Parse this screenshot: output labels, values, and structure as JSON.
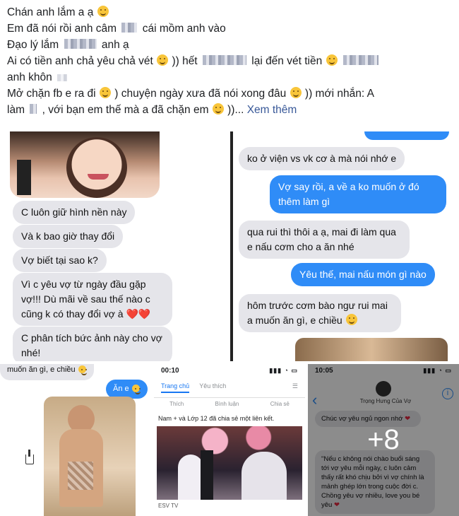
{
  "post": {
    "line1": "Chán anh lắm a ạ",
    "line2a": "Em đã nói rồi anh câm",
    "line2b": "cái mồm anh vào",
    "line3a": "Đạo lý lắm",
    "line3b": "anh ạ",
    "line4a": "Ai có tiền anh chả yêu chả vét",
    "line4b": ")) hết",
    "line4c": "lại đến vét tiền",
    "line5": "anh khôn",
    "line6a": "Mở chặn fb e ra đi",
    "line6b": ") chuyện ngày xưa đã nói xong đâu",
    "line6c": ")) mới nhắn: A",
    "line7a": "làm",
    "line7b": ", với bạn em thế mà a đã chặn em",
    "line7c": "))...",
    "see_more": "Xem thêm"
  },
  "photo1": {
    "messages": [
      "C luôn giữ hình nền này",
      "Và k bao giờ thay đổi",
      "Vợ biết tại sao k?",
      "Vì c yêu vợ từ ngày đầu gặp vợ!!! Dù mãi về sau thế nào c cũng k có thay đổi vợ à",
      "C phân tích bức ảnh này cho vợ nhé!"
    ],
    "hearts": "❤️❤️"
  },
  "photo2": {
    "messages": [
      {
        "dir": "in",
        "text": "ko ở viện vs vk cơ à mà nói nhớ e"
      },
      {
        "dir": "out",
        "text": "Vợ say rồi, a về a ko muốn ở đó thêm làm gì"
      },
      {
        "dir": "in",
        "text": "qua rui thì thôi a ạ, mai đi làm qua e nấu cơm cho a ăn nhé"
      },
      {
        "dir": "out",
        "text": "Yêu thế, mai nấu món gì nào"
      },
      {
        "dir": "in",
        "text": "hôm trước cơm bào ngư rui mai a muốn ăn gì, e chiều"
      }
    ]
  },
  "photo3": {
    "top_text": "muốn ăn gì, e chiều",
    "reply": "Ăn e"
  },
  "photo4": {
    "time": "00:10",
    "tabs": [
      "Trang chủ",
      "Yêu thích"
    ],
    "actions": [
      "Thích",
      "Bình luận",
      "Chia sẻ"
    ],
    "shared_text": "Nam + và Lớp 12 đã chia sẻ một liên kết.",
    "source": "ESV TV"
  },
  "photo5": {
    "time": "10:05",
    "contact": "Trọng Hưng Của Vợ",
    "msg1": "Chúc vợ yêu ngủ ngon nhớ",
    "msg2": "\"Nếu c không nói chào buổi sáng tới vợ yêu mỗi ngày, c luôn cảm thấy rất khó chịu bởi vì vợ chính là mảnh ghép lớn trong cuộc đời c. Chồng yêu vợ nhiều, love you bé yêu",
    "more_count": "+8"
  }
}
